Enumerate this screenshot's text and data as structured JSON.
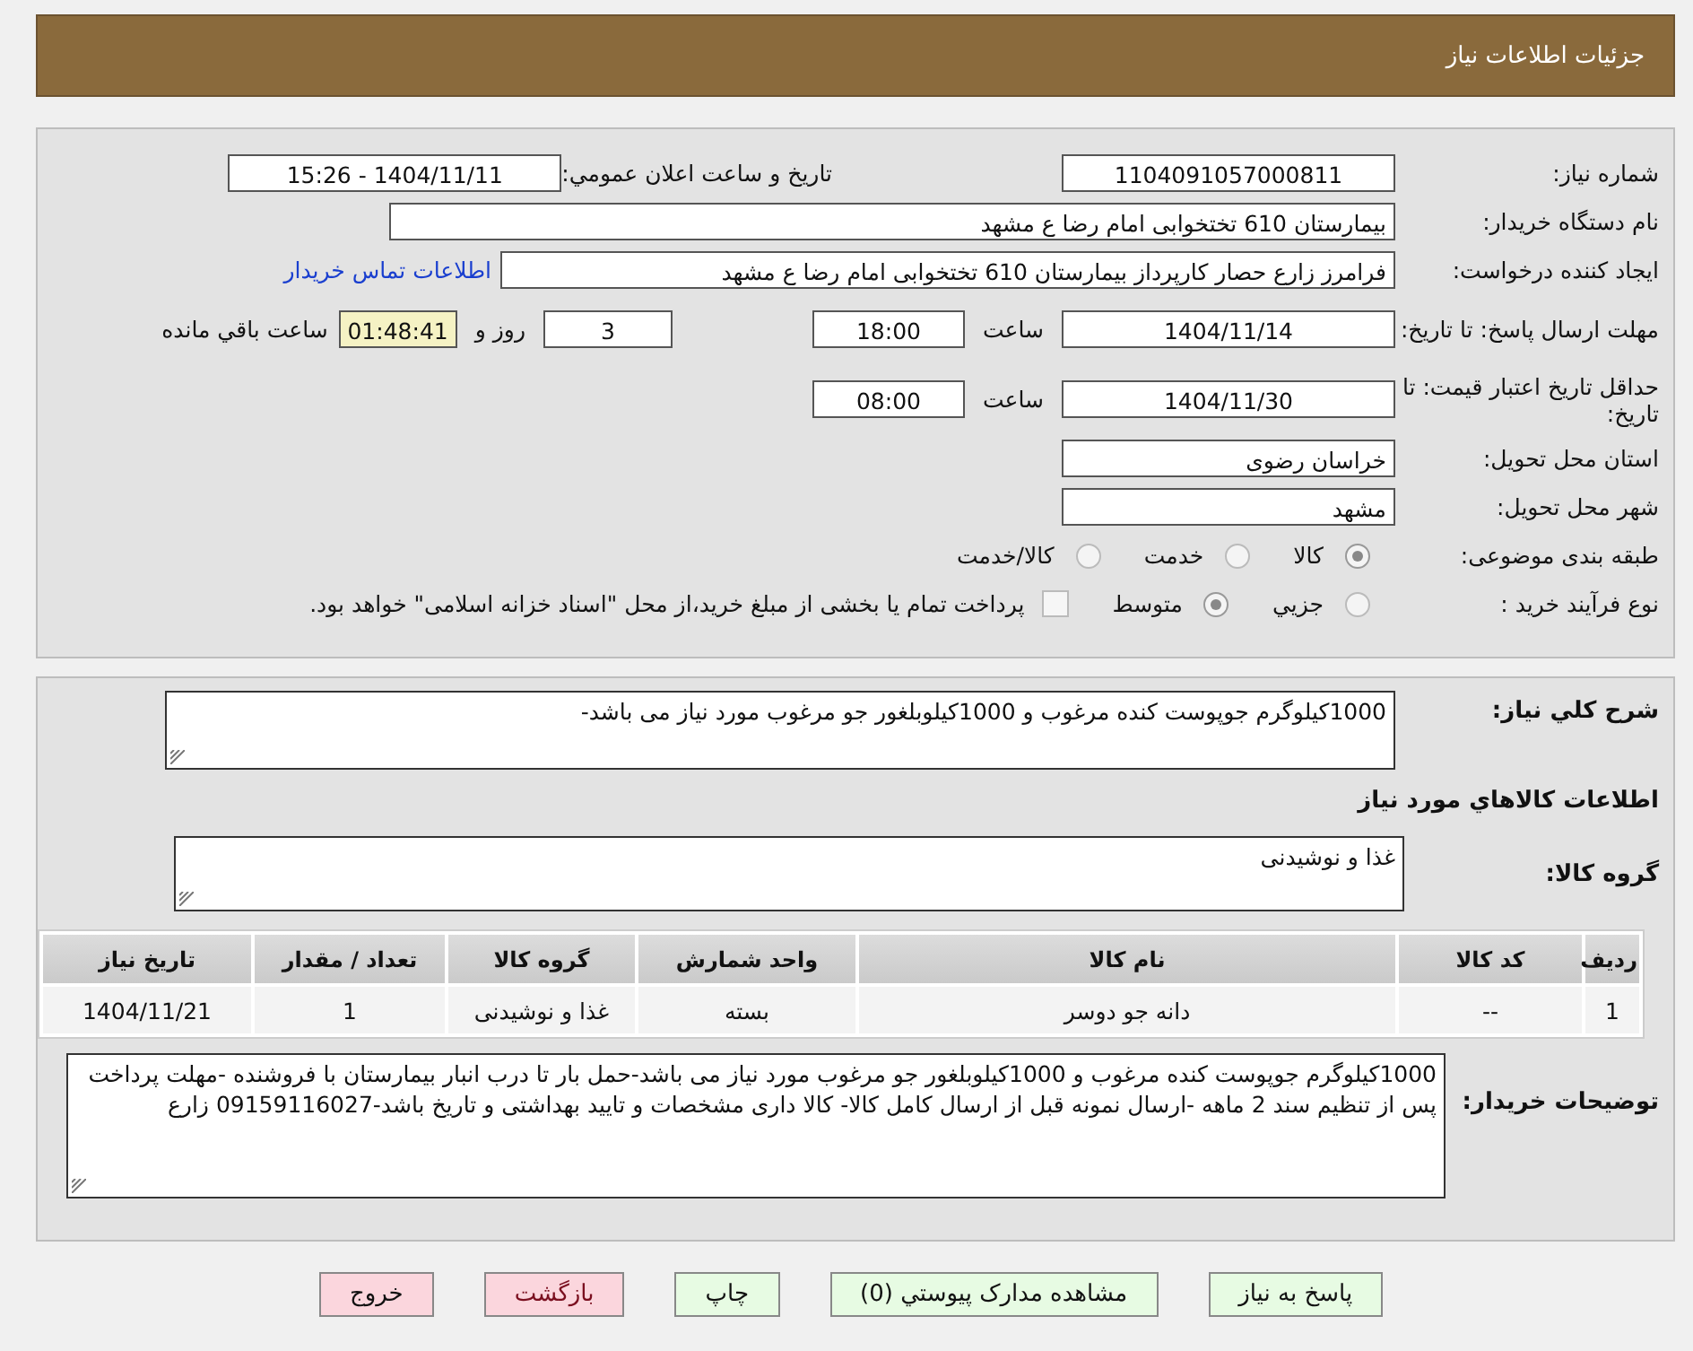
{
  "header": {
    "title": "جزئیات اطلاعات نیاز"
  },
  "need_number": {
    "label": "شماره نیاز:",
    "value": "1104091057000811"
  },
  "announce": {
    "label": "تاريخ و ساعت اعلان عمومي:",
    "value": "1404/11/11 - 15:26"
  },
  "buyer": {
    "label": "نام دستگاه خریدار:",
    "value": "بیمارستان 610 تختخوابی امام رضا ع  مشهد"
  },
  "creator": {
    "label": "ایجاد کننده درخواست:",
    "value": "فرامرز زارع حصار کارپرداز بیمارستان 610 تختخوابی امام رضا ع  مشهد",
    "link": "اطلاعات تماس خریدار"
  },
  "deadline": {
    "label": "مهلت ارسال پاسخ: تا تاریخ:",
    "date": "1404/11/14",
    "time_label": "ساعت",
    "time": "18:00",
    "days": "3",
    "days_label": "روز و",
    "remaining": "01:48:41",
    "remaining_label": "ساعت باقي مانده"
  },
  "validity": {
    "label": "حداقل تاریخ اعتبار قیمت: تا تاریخ:",
    "date": "1404/11/30",
    "time_label": "ساعت",
    "time": "08:00"
  },
  "province": {
    "label": "استان محل تحویل:",
    "value": "خراسان رضوی"
  },
  "city": {
    "label": "شهر محل تحویل:",
    "value": "مشهد"
  },
  "category": {
    "label": "طبقه بندی موضوعی:",
    "options": [
      {
        "label": "کالا",
        "selected": true
      },
      {
        "label": "خدمت",
        "selected": false
      },
      {
        "label": "کالا/خدمت",
        "selected": false
      }
    ]
  },
  "process": {
    "label": "نوع فرآیند خرید :",
    "options": [
      {
        "label": "جزيي",
        "selected": false
      },
      {
        "label": "متوسط",
        "selected": true
      }
    ],
    "payment": {
      "checked": false,
      "text": "پرداخت تمام یا بخشی از مبلغ خرید،از محل \"اسناد خزانه اسلامی\" خواهد بود."
    }
  },
  "description": {
    "label": "شرح کلي نياز:",
    "value": "1000کیلوگرم جوپوست کنده مرغوب و 1000کیلوبلغور جو مرغوب مورد نیاز می باشد-"
  },
  "goods_heading": "اطلاعات کالاهاي مورد نياز",
  "goods_group": {
    "label": "گروه کالا:",
    "value": "غذا و نوشیدنی"
  },
  "table": {
    "columns": [
      "ردیف",
      "کد کالا",
      "نام کالا",
      "واحد شمارش",
      "گروه کالا",
      "تعداد / مقدار",
      "تاریخ نیاز"
    ],
    "rows": [
      [
        "1",
        "--",
        "دانه جو دوسر",
        "بسته",
        "غذا و نوشیدنی",
        "1",
        "1404/11/21"
      ]
    ]
  },
  "buyer_notes": {
    "label": "توضیحات خریدار:",
    "value": "1000کیلوگرم جوپوست کنده مرغوب و 1000کیلوبلغور جو مرغوب مورد نیاز می باشد-حمل بار تا درب انبار بیمارستان با فروشنده -مهلت پرداخت پس از تنظیم سند 2 ماهه -ارسال نمونه قبل از ارسال کامل کالا- کالا داری مشخصات و تایید بهداشتی و تاریخ باشد-09159116027 زارع"
  },
  "buttons": [
    {
      "label": "پاسخ به نیاز",
      "kind": "normal"
    },
    {
      "label": "مشاهده مدارک پیوستي (0)",
      "kind": "normal"
    },
    {
      "label": "چاپ",
      "kind": "normal"
    },
    {
      "label": "بازگشت",
      "kind": "back"
    },
    {
      "label": "خروج",
      "kind": "exit"
    }
  ]
}
